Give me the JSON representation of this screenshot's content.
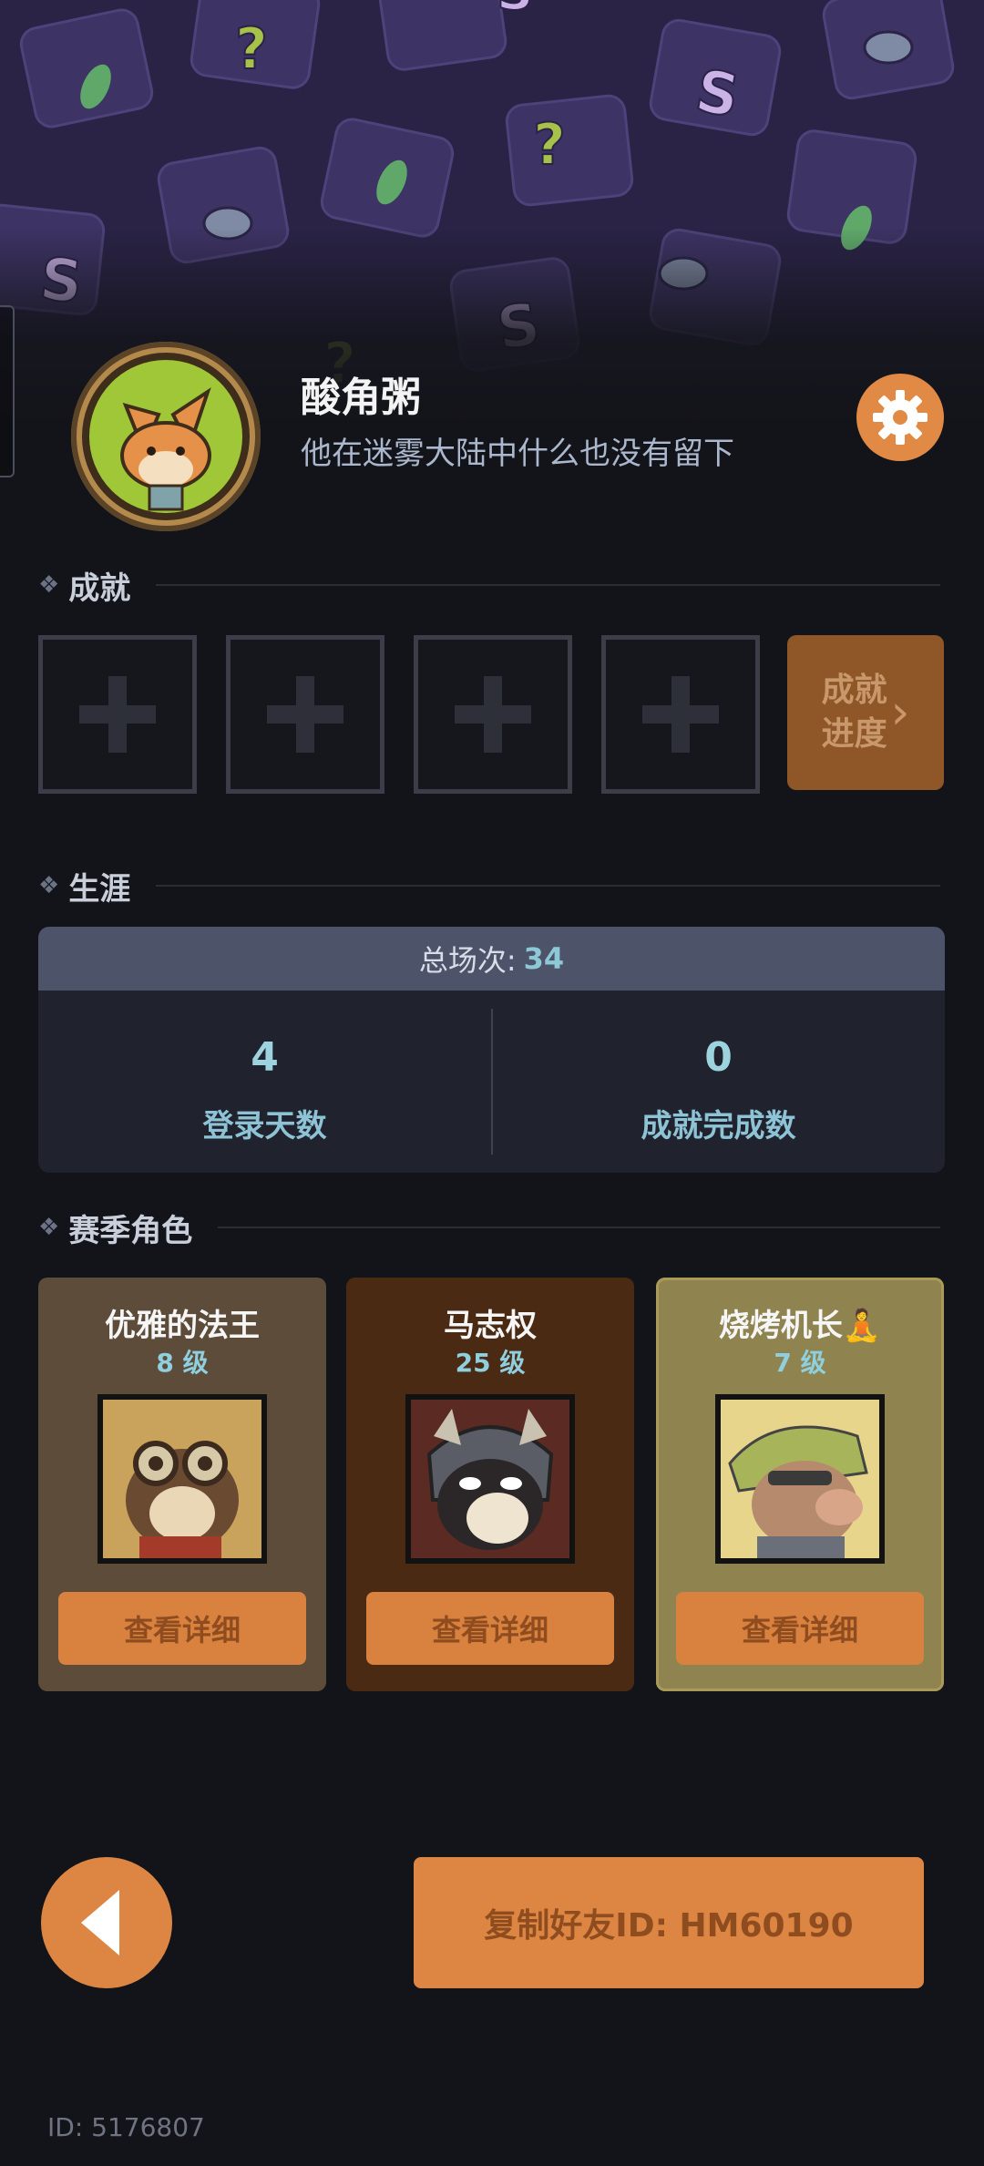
{
  "profile": {
    "name": "酸角粥",
    "motto": "他在迷雾大陆中什么也没有留下"
  },
  "sections": {
    "achievements": "成就",
    "career": "生涯",
    "season_characters": "赛季角色"
  },
  "achievements": {
    "progress_line1": "成就",
    "progress_line2": "进度"
  },
  "career": {
    "total_label": "总场次:",
    "total_value": "34",
    "stats": [
      {
        "value": "4",
        "label": "登录天数"
      },
      {
        "value": "0",
        "label": "成就完成数"
      }
    ]
  },
  "characters": [
    {
      "name": "优雅的法王",
      "level": "8 级",
      "button": "查看详细",
      "card_color": "#5e4c3a"
    },
    {
      "name": "马志权",
      "level": "25 级",
      "button": "查看详细",
      "card_color": "#4b2a14"
    },
    {
      "name": "烧烤机长🧘",
      "level": "7 级",
      "button": "查看详细",
      "card_color": "#8f8350"
    }
  ],
  "footer": {
    "copy_button": "复制好友ID: HM60190",
    "user_id": "ID: 5176807"
  },
  "colors": {
    "accent_orange": "#dd8643",
    "banner_purple": "#2a2346",
    "stat_blue": "#8fd0e0"
  },
  "icons": [
    "settings-gear-icon",
    "back-arrow-icon",
    "plus-icon",
    "chevron-right-icon",
    "diamond-bullet-icon"
  ]
}
